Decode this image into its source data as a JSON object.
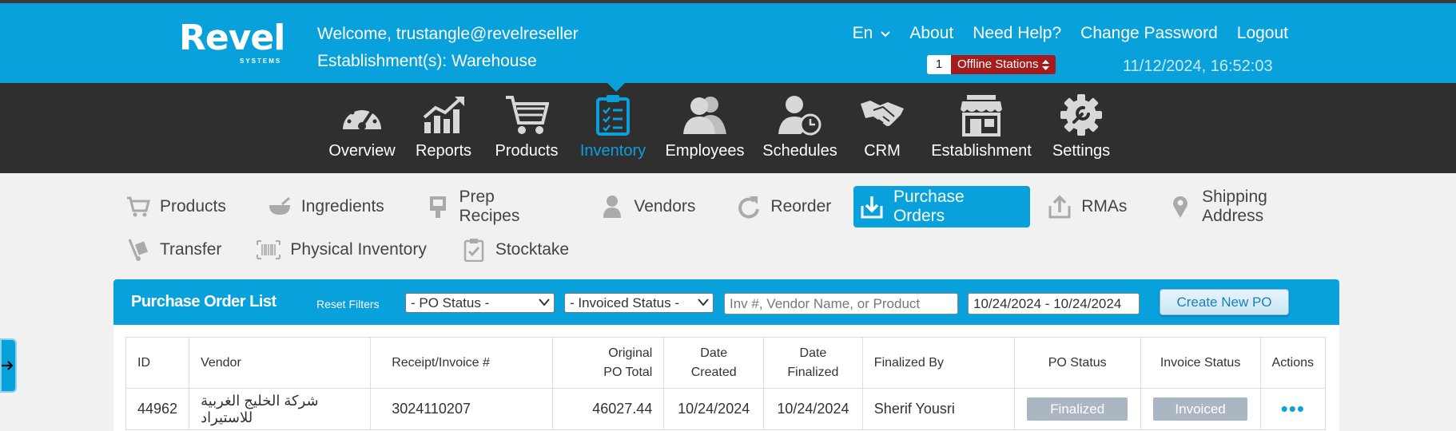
{
  "brand": {
    "name": "Revel",
    "sub": "SYSTEMS"
  },
  "user": {
    "welcome": "Welcome, trustangle@revelreseller",
    "establishment": "Establishment(s): Warehouse"
  },
  "topnav": {
    "lang": "En",
    "about": "About",
    "help": "Need Help?",
    "change_password": "Change Password",
    "logout": "Logout"
  },
  "offline": {
    "count": "1",
    "label": "Offline Stations"
  },
  "datetime": "11/12/2024, 16:52:03",
  "mainnav": [
    {
      "label": "Overview",
      "icon": "gauge-icon"
    },
    {
      "label": "Reports",
      "icon": "chart-icon"
    },
    {
      "label": "Products",
      "icon": "cart-icon"
    },
    {
      "label": "Inventory",
      "icon": "clipboard-icon",
      "active": true
    },
    {
      "label": "Employees",
      "icon": "people-icon"
    },
    {
      "label": "Schedules",
      "icon": "person-clock-icon"
    },
    {
      "label": "CRM",
      "icon": "handshake-icon"
    },
    {
      "label": "Establishment",
      "icon": "store-icon"
    },
    {
      "label": "Settings",
      "icon": "gear-icon"
    }
  ],
  "subnav": [
    {
      "label": "Products",
      "icon": "cart-icon"
    },
    {
      "label": "Ingredients",
      "icon": "bowl-icon"
    },
    {
      "label": "Prep Recipes",
      "icon": "recipe-icon"
    },
    {
      "label": "Vendors",
      "icon": "person-icon"
    },
    {
      "label": "Reorder",
      "icon": "redo-icon"
    },
    {
      "label": "Purchase Orders",
      "icon": "download-tray-icon",
      "active": true
    },
    {
      "label": "RMAs",
      "icon": "upload-tray-icon"
    },
    {
      "label": "Shipping Address",
      "icon": "map-pin-icon"
    },
    {
      "label": "Transfer",
      "icon": "hand-truck-icon"
    },
    {
      "label": "Physical Inventory",
      "icon": "barcode-icon"
    },
    {
      "label": "Stocktake",
      "icon": "checklist-icon"
    }
  ],
  "panel": {
    "title": "Purchase Order List",
    "reset": "Reset Filters",
    "po_status": "- PO Status -",
    "invoiced_status": "- Invoiced Status -",
    "search_placeholder": "Inv #, Vendor Name, or Product",
    "date_range": "10/24/2024 - 10/24/2024",
    "create": "Create New PO"
  },
  "table": {
    "headers": {
      "id": "ID",
      "vendor": "Vendor",
      "receipt": "Receipt/Invoice #",
      "total_1": "Original",
      "total_2": "PO Total",
      "created_1": "Date",
      "created_2": "Created",
      "finalized_1": "Date",
      "finalized_2": "Finalized",
      "finalized_by": "Finalized By",
      "po_status": "PO Status",
      "invoice_status": "Invoice Status",
      "actions": "Actions"
    },
    "rows": [
      {
        "id": "44962",
        "vendor": "شركة الخليج الغربية للاستيراد",
        "receipt": "3024110207",
        "total": "46027.44",
        "created": "10/24/2024",
        "finalized": "10/24/2024",
        "finalized_by": "Sherif Yousri",
        "po_status": "Finalized",
        "invoice_status": "Invoiced",
        "actions": "•••"
      }
    ]
  },
  "colors": {
    "accent": "#09a1dc",
    "nav_bg": "#2f2f2f",
    "offline_red": "#a51c1c",
    "badge": "#aab6c2"
  }
}
